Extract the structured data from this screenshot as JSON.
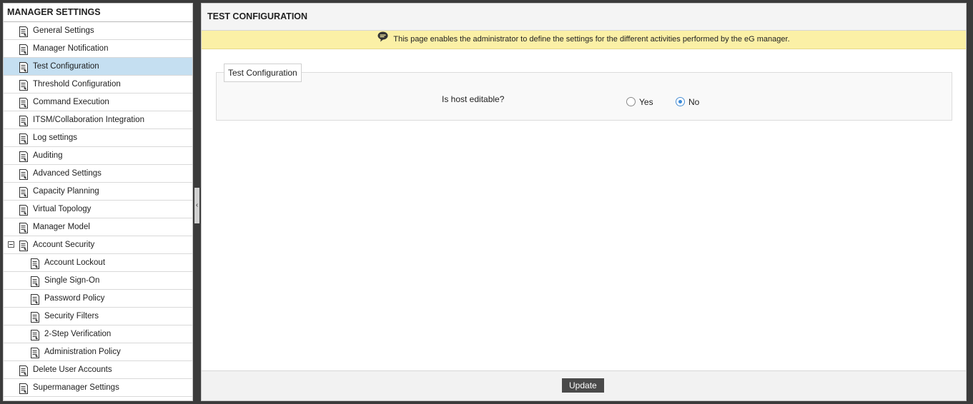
{
  "sidebar": {
    "title": "MANAGER SETTINGS",
    "items": [
      {
        "label": "General Settings",
        "level": 0
      },
      {
        "label": "Manager Notification",
        "level": 0
      },
      {
        "label": "Test Configuration",
        "level": 0,
        "selected": true
      },
      {
        "label": "Threshold Configuration",
        "level": 0
      },
      {
        "label": "Command Execution",
        "level": 0
      },
      {
        "label": "ITSM/Collaboration Integration",
        "level": 0
      },
      {
        "label": "Log settings",
        "level": 0
      },
      {
        "label": "Auditing",
        "level": 0
      },
      {
        "label": "Advanced Settings",
        "level": 0
      },
      {
        "label": "Capacity Planning",
        "level": 0
      },
      {
        "label": "Virtual Topology",
        "level": 0
      },
      {
        "label": "Manager Model",
        "level": 0
      },
      {
        "label": "Account Security",
        "level": 0,
        "expanded": true
      },
      {
        "label": "Account Lockout",
        "level": 1
      },
      {
        "label": "Single Sign-On",
        "level": 1
      },
      {
        "label": "Password Policy",
        "level": 1
      },
      {
        "label": "Security Filters",
        "level": 1
      },
      {
        "label": "2-Step Verification",
        "level": 1
      },
      {
        "label": "Administration Policy",
        "level": 1
      },
      {
        "label": "Delete User Accounts",
        "level": 0
      },
      {
        "label": "Supermanager Settings",
        "level": 0
      }
    ]
  },
  "splitter": {
    "icon": "chevron-left-icon",
    "glyph": "‹"
  },
  "main": {
    "header_title": "TEST CONFIGURATION",
    "banner_text": "This page enables the administrator to define the settings for the different activities performed by the eG manager.",
    "fieldset_legend": "Test Configuration",
    "field_label": "Is host editable?",
    "options": [
      {
        "label": "Yes",
        "checked": false
      },
      {
        "label": "No",
        "checked": true
      }
    ],
    "update_label": "Update"
  },
  "colors": {
    "selected_row": "#c5dff1",
    "banner": "#fbf0a6",
    "radio_accent": "#3b8ad8",
    "button": "#4a4a4a"
  }
}
